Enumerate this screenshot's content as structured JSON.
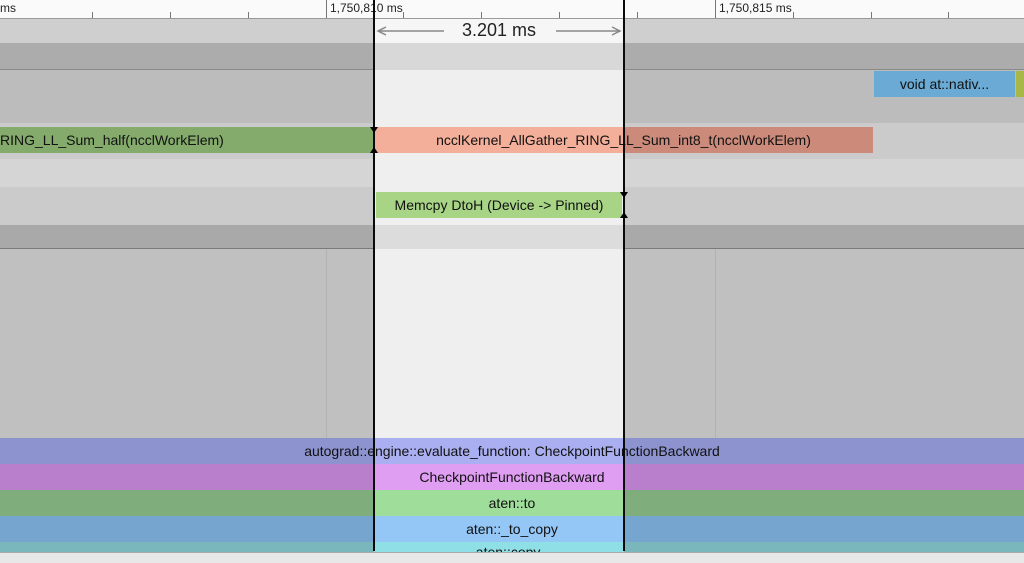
{
  "ruler": {
    "labels": [
      "ms",
      "1,750,810 ms",
      "1,750,815 ms"
    ]
  },
  "selection": {
    "duration": "3.201 ms"
  },
  "slices": {
    "void_native": "void at::nativ...",
    "ring_half": "RING_LL_Sum_half(ncclWorkElem)",
    "allgather": "ncclKernel_AllGather_RING_LL_Sum_int8_t(ncclWorkElem)",
    "memcpy": "Memcpy DtoH (Device -> Pinned)",
    "autograd": "autograd::engine::evaluate_function: CheckpointFunctionBackward",
    "checkpoint": "CheckpointFunctionBackward",
    "aten_to": "aten::to",
    "aten_to_copy": "aten::_to_copy",
    "aten_copy": "aten::copy_"
  },
  "colors": {
    "blue_slice": "#6aaad4",
    "green_slice": "#84ab6c",
    "salmon_slice": "#cc8a7b",
    "memcpy_slice": "#a8d486",
    "autograd": "#8c93cf",
    "checkpoint": "#b97fcc",
    "aten_to": "#7fae7c",
    "aten_to_copy": "#76a6d0"
  }
}
